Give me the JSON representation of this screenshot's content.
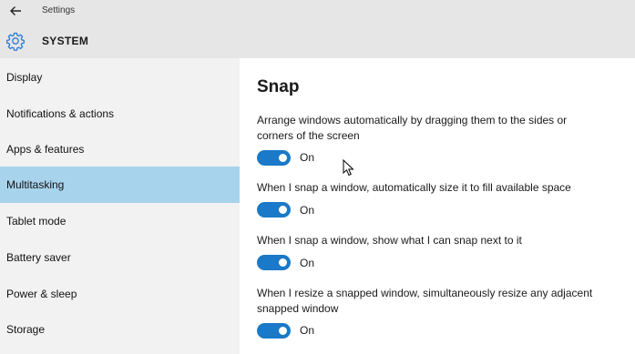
{
  "window": {
    "title": "Settings",
    "back_icon": "arrow-left-icon"
  },
  "header": {
    "icon": "gear-icon",
    "title": "SYSTEM",
    "accent": "#2b7cd3"
  },
  "sidebar": {
    "selected_color": "#a8d3ec",
    "items": [
      {
        "label": "Display",
        "selected": false
      },
      {
        "label": "Notifications & actions",
        "selected": false
      },
      {
        "label": "Apps & features",
        "selected": false
      },
      {
        "label": "Multitasking",
        "selected": true
      },
      {
        "label": "Tablet mode",
        "selected": false
      },
      {
        "label": "Battery saver",
        "selected": false
      },
      {
        "label": "Power & sleep",
        "selected": false
      },
      {
        "label": "Storage",
        "selected": false
      }
    ]
  },
  "main": {
    "heading": "Snap",
    "toggle_color": "#1a79c8",
    "settings": [
      {
        "label": "Arrange windows automatically by dragging them to the sides or corners of the screen",
        "state": "On",
        "enabled": true
      },
      {
        "label": "When I snap a window, automatically size it to fill available space",
        "state": "On",
        "enabled": true
      },
      {
        "label": "When I snap a window, show what I can snap next to it",
        "state": "On",
        "enabled": true
      },
      {
        "label": "When I resize a snapped window, simultaneously resize any adjacent snapped window",
        "state": "On",
        "enabled": true
      }
    ]
  }
}
